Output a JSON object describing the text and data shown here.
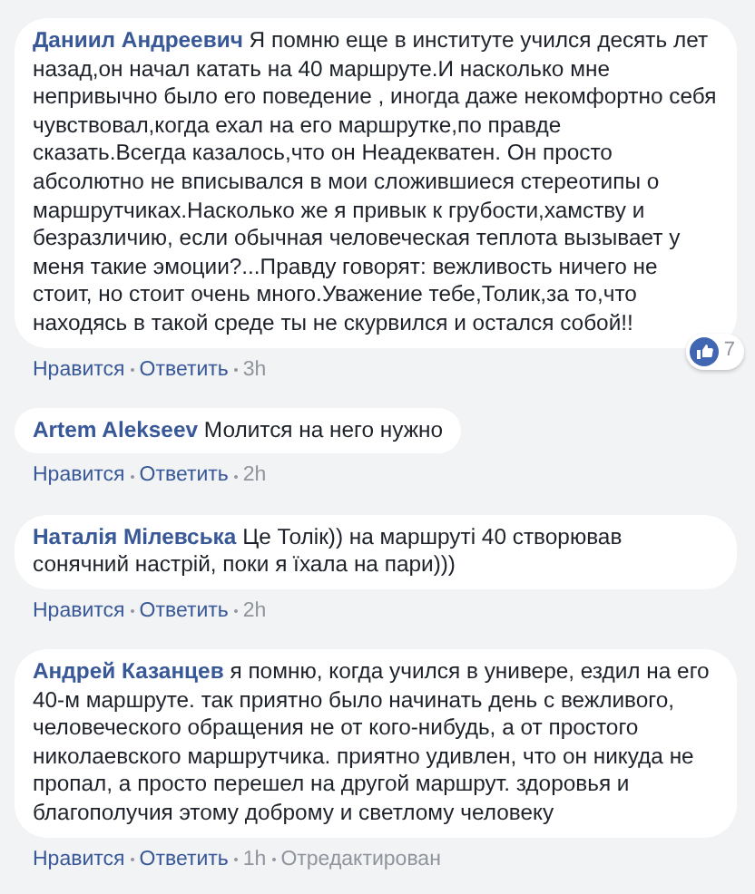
{
  "comments": [
    {
      "author": "Даниил Андреевич",
      "text": "Я помню еще в институте учился десять лет назад,он начал катать на 40 маршруте.И насколько мне непривычно было его поведение , иногда даже некомфортно себя чувствовал,когда ехал на его маршрутке,по правде сказать.Всегда казалось,что он Неадекватен. Он просто абсолютно не вписывался в мои сложившиеся стереотипы о маршрутчиках.Насколько же я привык к грубости,хамству и безразличию, если обычная человеческая теплота вызывает у меня такие эмоции?...Правду говорят: вежливость ничего не стоит, но стоит очень много.Уважение тебе,Толик,за то,что находясь в такой среде ты не скурвился и остался собой!!",
      "reactions": "7",
      "actions": [
        "Нравится",
        "Ответить"
      ],
      "time": "3h"
    },
    {
      "author": "Artem Alekseev",
      "text": "Молится на него нужно",
      "actions": [
        "Нравится",
        "Ответить"
      ],
      "time": "2h"
    },
    {
      "author": "Наталія Мілевська",
      "text": "Це Толік)) на маршруті 40 створював сонячний настрій, поки я їхала на пари)))",
      "actions": [
        "Нравится",
        "Ответить"
      ],
      "time": "2h"
    },
    {
      "author": "Андрей Казанцев",
      "text": "я помню, когда учился в универе, ездил на его 40-м маршруте. так приятно было начинать день с вежливого, человеческого обращения не от кого-нибудь, а от простого николаевского маршрутчика. приятно удивлен, что он никуда не пропал, а просто перешел на другой маршрут. здоровья и благополучия этому доброму и светлому человеку",
      "actions": [
        "Нравится",
        "Ответить"
      ],
      "time": "1h",
      "edited": "Отредактирован"
    }
  ]
}
